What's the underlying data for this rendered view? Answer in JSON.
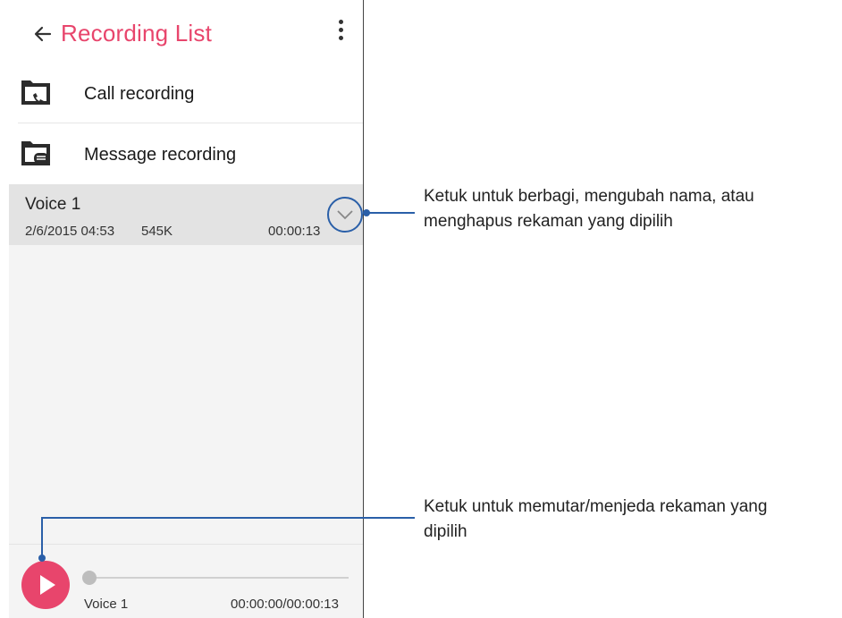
{
  "app": {
    "title": "Recording List",
    "back_icon": "arrow-left-icon",
    "menu_icon": "more-vert-icon",
    "accent_color": "#e8456c"
  },
  "folders": [
    {
      "label": "Call recording",
      "icon": "call-folder-icon"
    },
    {
      "label": "Message recording",
      "icon": "message-folder-icon"
    }
  ],
  "recording": {
    "name": "Voice 1",
    "date": "2/6/2015 04:53",
    "size": "545K",
    "duration": "00:00:13",
    "expand_icon": "chevron-down-icon"
  },
  "player": {
    "name": "Voice 1",
    "time": "00:00:00/00:00:13",
    "progress": 0,
    "play_icon": "play-icon"
  },
  "callouts": {
    "expand_line1": "Ketuk untuk berbagi, mengubah nama, atau",
    "expand_line2": "menghapus rekaman yang dipilih",
    "play_line1": "Ketuk untuk memutar/menjeda rekaman yang",
    "play_line2": "dipilih",
    "line_color": "#2a5fa8"
  }
}
